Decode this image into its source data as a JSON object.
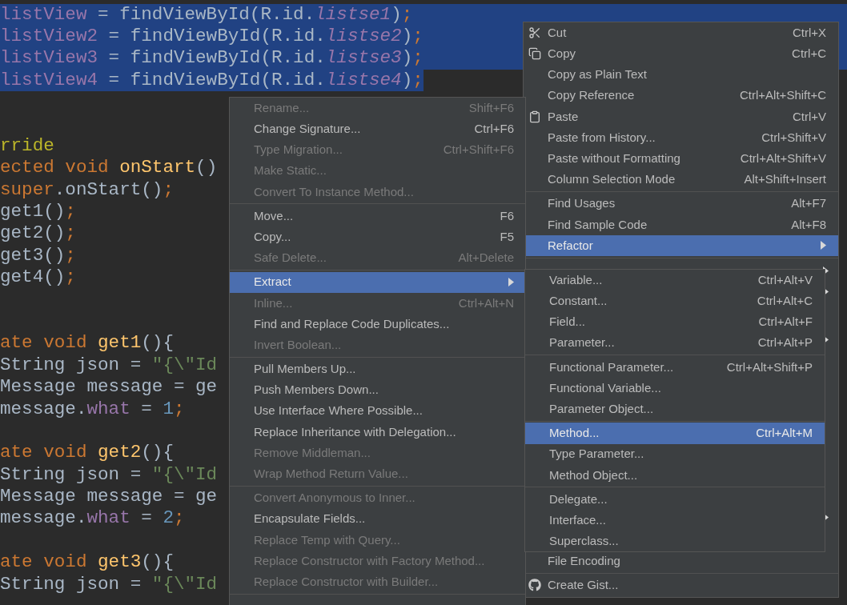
{
  "editor": {
    "lines": [
      {
        "selected": true,
        "tokens": [
          {
            "text": "listView",
            "kind": "field"
          },
          {
            "text": " = findViewById(R.id.",
            "kind": "plain"
          },
          {
            "text": "listse1",
            "kind": "static"
          },
          {
            "text": ")",
            "kind": "plain"
          },
          {
            "text": ";",
            "kind": "keyword"
          }
        ]
      },
      {
        "selected": true,
        "tokens": [
          {
            "text": "listView2",
            "kind": "field"
          },
          {
            "text": " = findViewById(R.id.",
            "kind": "plain"
          },
          {
            "text": "listse2",
            "kind": "static"
          },
          {
            "text": ")",
            "kind": "plain"
          },
          {
            "text": ";",
            "kind": "keyword"
          }
        ]
      },
      {
        "selected": true,
        "tokens": [
          {
            "text": "listView3",
            "kind": "field"
          },
          {
            "text": " = findViewById(R.id.",
            "kind": "plain"
          },
          {
            "text": "listse3",
            "kind": "static"
          },
          {
            "text": ")",
            "kind": "plain"
          },
          {
            "text": ";",
            "kind": "keyword"
          }
        ]
      },
      {
        "selected": true,
        "tokens": [
          {
            "text": "listView4",
            "kind": "field"
          },
          {
            "text": " = findViewById(R.id.",
            "kind": "plain"
          },
          {
            "text": "listse4",
            "kind": "static"
          },
          {
            "text": ")",
            "kind": "plain"
          },
          {
            "text": ";",
            "kind": "keyword"
          }
        ]
      },
      {
        "selected": false
      },
      {
        "selected": false
      },
      {
        "selected": false,
        "tokens": [
          {
            "text": "rride",
            "kind": "annotation"
          }
        ]
      },
      {
        "selected": false,
        "tokens": [
          {
            "text": "ected void ",
            "kind": "keyword"
          },
          {
            "text": "onStart",
            "kind": "method"
          },
          {
            "text": "()",
            "kind": "plain"
          }
        ]
      },
      {
        "selected": false,
        "tokens": [
          {
            "text": "super",
            "kind": "keyword"
          },
          {
            "text": ".onStart()",
            "kind": "plain"
          },
          {
            "text": ";",
            "kind": "keyword"
          }
        ]
      },
      {
        "selected": false,
        "tokens": [
          {
            "text": "get1()",
            "kind": "plain"
          },
          {
            "text": ";",
            "kind": "keyword"
          }
        ]
      },
      {
        "selected": false,
        "tokens": [
          {
            "text": "get2()",
            "kind": "plain"
          },
          {
            "text": ";",
            "kind": "keyword"
          }
        ]
      },
      {
        "selected": false,
        "tokens": [
          {
            "text": "get3()",
            "kind": "plain"
          },
          {
            "text": ";",
            "kind": "keyword"
          }
        ]
      },
      {
        "selected": false,
        "tokens": [
          {
            "text": "get4()",
            "kind": "plain"
          },
          {
            "text": ";",
            "kind": "keyword"
          }
        ]
      },
      {
        "selected": false
      },
      {
        "selected": false
      },
      {
        "selected": false,
        "tokens": [
          {
            "text": "ate void ",
            "kind": "keyword"
          },
          {
            "text": "get1",
            "kind": "method"
          },
          {
            "text": "(){",
            "kind": "plain"
          }
        ]
      },
      {
        "selected": false,
        "tokens": [
          {
            "text": "String json = ",
            "kind": "plain"
          },
          {
            "text": "\"{\\\"Id",
            "kind": "string"
          }
        ]
      },
      {
        "selected": false,
        "tokens": [
          {
            "text": "Message message = ge",
            "kind": "plain"
          }
        ]
      },
      {
        "selected": false,
        "tokens": [
          {
            "text": "message.",
            "kind": "plain"
          },
          {
            "text": "what",
            "kind": "field"
          },
          {
            "text": " = ",
            "kind": "plain"
          },
          {
            "text": "1",
            "kind": "number"
          },
          {
            "text": ";",
            "kind": "keyword"
          }
        ]
      },
      {
        "selected": false
      },
      {
        "selected": false,
        "tokens": [
          {
            "text": "ate void ",
            "kind": "keyword"
          },
          {
            "text": "get2",
            "kind": "method"
          },
          {
            "text": "(){",
            "kind": "plain"
          }
        ]
      },
      {
        "selected": false,
        "tokens": [
          {
            "text": "String json = ",
            "kind": "plain"
          },
          {
            "text": "\"{\\\"Id",
            "kind": "string"
          }
        ]
      },
      {
        "selected": false,
        "tokens": [
          {
            "text": "Message message = ge",
            "kind": "plain"
          }
        ]
      },
      {
        "selected": false,
        "tokens": [
          {
            "text": "message.",
            "kind": "plain"
          },
          {
            "text": "what",
            "kind": "field"
          },
          {
            "text": " = ",
            "kind": "plain"
          },
          {
            "text": "2",
            "kind": "number"
          },
          {
            "text": ";",
            "kind": "keyword"
          }
        ]
      },
      {
        "selected": false
      },
      {
        "selected": false,
        "tokens": [
          {
            "text": "ate void ",
            "kind": "keyword"
          },
          {
            "text": "get3",
            "kind": "method"
          },
          {
            "text": "(){",
            "kind": "plain"
          }
        ]
      },
      {
        "selected": false,
        "tokens": [
          {
            "text": "String json = ",
            "kind": "plain"
          },
          {
            "text": "\"{\\\"Id",
            "kind": "string"
          }
        ]
      }
    ]
  },
  "context_menu": {
    "top_sections": [
      [
        {
          "label": "Cut",
          "shortcut": "Ctrl+X",
          "disabled": false,
          "selected": false,
          "submenu": false
        },
        {
          "label": "Copy",
          "shortcut": "Ctrl+C",
          "disabled": false,
          "selected": false,
          "submenu": false
        },
        {
          "label": "Copy as Plain Text",
          "disabled": false,
          "selected": false,
          "submenu": false
        },
        {
          "label": "Copy Reference",
          "shortcut": "Ctrl+Alt+Shift+C",
          "disabled": false,
          "selected": false,
          "submenu": false
        },
        {
          "label": "Paste",
          "shortcut": "Ctrl+V",
          "disabled": false,
          "selected": false,
          "submenu": false
        },
        {
          "label": "Paste from History...",
          "shortcut": "Ctrl+Shift+V",
          "disabled": false,
          "selected": false,
          "submenu": false
        },
        {
          "label": "Paste without Formatting",
          "shortcut": "Ctrl+Alt+Shift+V",
          "disabled": false,
          "selected": false,
          "submenu": false
        },
        {
          "label": "Column Selection Mode",
          "shortcut": "Alt+Shift+Insert",
          "disabled": false,
          "selected": false,
          "submenu": false
        }
      ],
      [
        {
          "label": "Find Usages",
          "shortcut": "Alt+F7",
          "disabled": false,
          "selected": false,
          "submenu": false
        },
        {
          "label": "Find Sample Code",
          "shortcut": "Alt+F8",
          "disabled": false,
          "selected": false,
          "submenu": false
        },
        {
          "label": "Refactor",
          "disabled": false,
          "selected": true,
          "submenu": true
        }
      ]
    ],
    "bottom_sections": [
      [
        {
          "label": "File Encoding",
          "disabled": false,
          "selected": false,
          "submenu": false
        }
      ],
      [
        {
          "label": "Create Gist...",
          "disabled": false,
          "selected": false,
          "submenu": false
        }
      ]
    ]
  },
  "refactor_menu": {
    "sections": [
      [
        {
          "label": "Rename...",
          "shortcut": "Shift+F6",
          "disabled": true,
          "selected": false,
          "submenu": false
        },
        {
          "label": "Change Signature...",
          "shortcut": "Ctrl+F6",
          "disabled": false,
          "selected": false,
          "submenu": false
        },
        {
          "label": "Type Migration...",
          "shortcut": "Ctrl+Shift+F6",
          "disabled": true,
          "selected": false,
          "submenu": false
        },
        {
          "label": "Make Static...",
          "disabled": true,
          "selected": false,
          "submenu": false
        },
        {
          "label": "Convert To Instance Method...",
          "disabled": true,
          "selected": false,
          "submenu": false
        }
      ],
      [
        {
          "label": "Move...",
          "shortcut": "F6",
          "disabled": false,
          "selected": false,
          "submenu": false
        },
        {
          "label": "Copy...",
          "shortcut": "F5",
          "disabled": false,
          "selected": false,
          "submenu": false
        },
        {
          "label": "Safe Delete...",
          "shortcut": "Alt+Delete",
          "disabled": true,
          "selected": false,
          "submenu": false
        }
      ],
      [
        {
          "label": "Extract",
          "disabled": false,
          "selected": true,
          "submenu": true
        },
        {
          "label": "Inline...",
          "shortcut": "Ctrl+Alt+N",
          "disabled": true,
          "selected": false,
          "submenu": false
        },
        {
          "label": "Find and Replace Code Duplicates...",
          "disabled": false,
          "selected": false,
          "submenu": false
        },
        {
          "label": "Invert Boolean...",
          "disabled": true,
          "selected": false,
          "submenu": false
        }
      ],
      [
        {
          "label": "Pull Members Up...",
          "disabled": false,
          "selected": false,
          "submenu": false
        },
        {
          "label": "Push Members Down...",
          "disabled": false,
          "selected": false,
          "submenu": false
        },
        {
          "label": "Use Interface Where Possible...",
          "disabled": false,
          "selected": false,
          "submenu": false
        },
        {
          "label": "Replace Inheritance with Delegation...",
          "disabled": false,
          "selected": false,
          "submenu": false
        },
        {
          "label": "Remove Middleman...",
          "disabled": true,
          "selected": false,
          "submenu": false
        },
        {
          "label": "Wrap Method Return Value...",
          "disabled": true,
          "selected": false,
          "submenu": false
        }
      ],
      [
        {
          "label": "Convert Anonymous to Inner...",
          "disabled": true,
          "selected": false,
          "submenu": false
        },
        {
          "label": "Encapsulate Fields...",
          "disabled": false,
          "selected": false,
          "submenu": false
        },
        {
          "label": "Replace Temp with Query...",
          "disabled": true,
          "selected": false,
          "submenu": false
        },
        {
          "label": "Replace Constructor with Factory Method...",
          "disabled": true,
          "selected": false,
          "submenu": false
        },
        {
          "label": "Replace Constructor with Builder...",
          "disabled": true,
          "selected": false,
          "submenu": false
        }
      ]
    ]
  },
  "extract_menu": {
    "sections": [
      [
        {
          "label": "Variable...",
          "shortcut": "Ctrl+Alt+V",
          "disabled": false,
          "selected": false,
          "submenu": false
        },
        {
          "label": "Constant...",
          "shortcut": "Ctrl+Alt+C",
          "disabled": false,
          "selected": false,
          "submenu": false
        },
        {
          "label": "Field...",
          "shortcut": "Ctrl+Alt+F",
          "disabled": false,
          "selected": false,
          "submenu": false
        },
        {
          "label": "Parameter...",
          "shortcut": "Ctrl+Alt+P",
          "disabled": false,
          "selected": false,
          "submenu": false
        }
      ],
      [
        {
          "label": "Functional Parameter...",
          "shortcut": "Ctrl+Alt+Shift+P",
          "disabled": false,
          "selected": false,
          "submenu": false
        },
        {
          "label": "Functional Variable...",
          "disabled": false,
          "selected": false,
          "submenu": false
        },
        {
          "label": "Parameter Object...",
          "disabled": false,
          "selected": false,
          "submenu": false
        }
      ],
      [
        {
          "label": "Method...",
          "shortcut": "Ctrl+Alt+M",
          "disabled": false,
          "selected": true,
          "submenu": false
        },
        {
          "label": "Type Parameter...",
          "disabled": false,
          "selected": false,
          "submenu": false
        },
        {
          "label": "Method Object...",
          "disabled": false,
          "selected": false,
          "submenu": false
        }
      ],
      [
        {
          "label": "Delegate...",
          "disabled": false,
          "selected": false,
          "submenu": false
        },
        {
          "label": "Interface...",
          "disabled": false,
          "selected": false,
          "submenu": false
        },
        {
          "label": "Superclass...",
          "disabled": false,
          "selected": false,
          "submenu": false
        }
      ]
    ]
  }
}
